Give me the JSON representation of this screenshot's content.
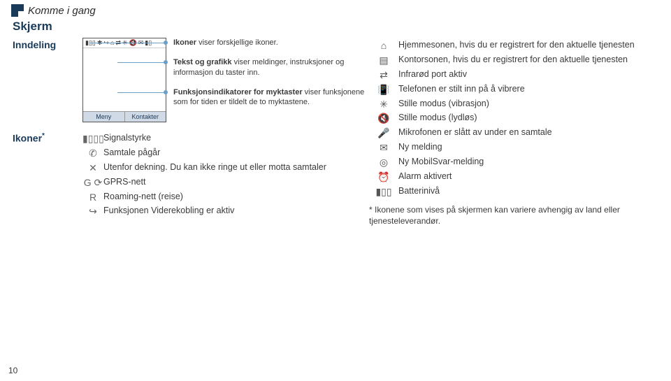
{
  "top_breadcrumb": "Komme i gang",
  "section_title": "Skjerm",
  "layout_label": "Inndeling",
  "icons_label_html": "Ikoner",
  "icons_sup": "*",
  "phone": {
    "soft_left": "Meny",
    "soft_right": "Kontakter"
  },
  "callouts": [
    {
      "title": "Ikoner",
      "desc": "viser forskjellige ikoner."
    },
    {
      "title": "Tekst og grafikk",
      "desc": "viser meldinger, instruksjoner og informasjon du taster inn."
    },
    {
      "title": "Funksjonsindikatorer for myktaster",
      "desc": "viser funksjonene som for tiden er tildelt de to myktastene."
    }
  ],
  "left_icons": [
    {
      "glyph": "▮▯▯▯",
      "text": "Signalstyrke"
    },
    {
      "glyph": "✆",
      "text": "Samtale pågår"
    },
    {
      "glyph": "✕",
      "text": "Utenfor dekning. Du kan ikke ringe ut eller motta samtaler"
    },
    {
      "glyph": "G ⟳",
      "text": "GPRS-nett"
    },
    {
      "glyph": "R",
      "text": "Roaming-nett (reise)"
    },
    {
      "glyph": "↪",
      "text": "Funksjonen Viderekobling er aktiv"
    }
  ],
  "right_icons": [
    {
      "glyph": "⌂",
      "text": "Hjemmesonen, hvis du er registrert for den aktuelle tjenesten"
    },
    {
      "glyph": "▤",
      "text": "Kontorsonen, hvis du er registrert for den aktuelle tjenesten"
    },
    {
      "glyph": "⇄",
      "text": "Infrarød port aktiv"
    },
    {
      "glyph": "📳",
      "text": "Telefonen er stilt inn på å vibrere"
    },
    {
      "glyph": "✳",
      "text": "Stille modus (vibrasjon)"
    },
    {
      "glyph": "🔇",
      "text": "Stille modus (lydløs)"
    },
    {
      "glyph": "🎤",
      "text": "Mikrofonen er slått av under en samtale"
    },
    {
      "glyph": "✉",
      "text": "Ny melding"
    },
    {
      "glyph": "◎",
      "text": "Ny MobilSvar-melding"
    },
    {
      "glyph": "⏰",
      "text": "Alarm aktivert"
    },
    {
      "glyph": "▮▯▯",
      "text": "Batterinivå"
    }
  ],
  "footnote": "* Ikonene som vises på skjermen kan variere avhengig av land eller tjenesteleverandør.",
  "page_number": "10"
}
